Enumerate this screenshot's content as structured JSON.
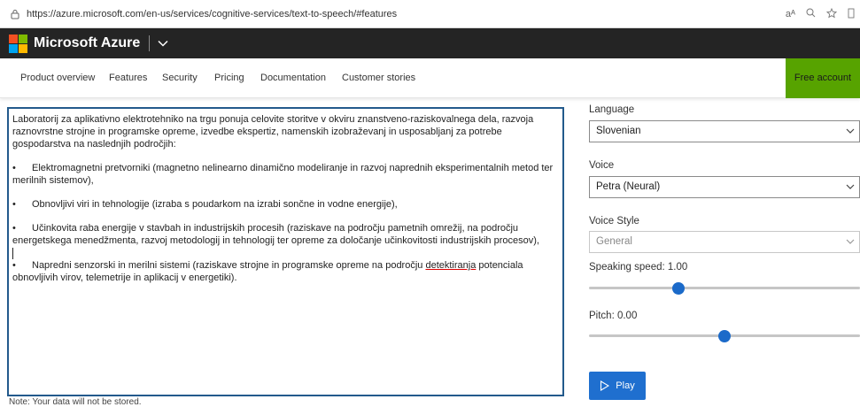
{
  "browser": {
    "url": "https://azure.microsoft.com/en-us/services/cognitive-services/text-to-speech/#features"
  },
  "header": {
    "brand": "Microsoft Azure",
    "logo_colors": [
      "#f25022",
      "#7fba00",
      "#00a4ef",
      "#ffb900"
    ]
  },
  "nav": {
    "items": [
      "Product overview",
      "Features",
      "Security",
      "Pricing",
      "Documentation",
      "Customer stories"
    ],
    "free_account": "Free account",
    "free_account_color": "#57a300"
  },
  "editor": {
    "intro": "Laboratorij za aplikativno elektrotehniko na trgu ponuja celovite storitve v okviru znanstveno-raziskovalnega dela, razvoja raznovrstne strojne in programske opreme, izvedbe ekspertiz, namenskih izobraževanj in usposabljanj za potrebe gospodarstva na naslednjih področjih:",
    "bullet_char": "•",
    "bullets": [
      "Elektromagnetni pretvorniki (magnetno nelinearno dinamično modeliranje in razvoj naprednih eksperimentalnih metod ter merilnih sistemov),",
      "Obnovljivi viri in tehnologije (izraba s poudarkom na izrabi sončne in vodne energije),",
      "Učinkovita raba energije v stavbah in industrijskih procesih (raziskave na področju pametnih omrežij, na področju energetskega menedžmenta, razvoj metodologij in tehnologij ter opreme za določanje učinkovitosti industrijskih procesov),"
    ],
    "last_bullet_before": "Napredni senzorski in merilni sistemi (raziskave strojne in programske opreme na področju ",
    "last_bullet_misspelled": "detektiranja",
    "last_bullet_after": " potenciala obnovljivih virov, telemetrije in aplikacij v energetiki).",
    "border_color": "#235a8c"
  },
  "note": "Note: Your data will not be stored.",
  "settings": {
    "language_label": "Language",
    "language_value": "Slovenian",
    "voice_label": "Voice",
    "voice_value": "Petra (Neural)",
    "style_label": "Voice Style",
    "style_value": "General",
    "speed_label": "Speaking speed: 1.00",
    "speed_fraction": 0.33,
    "pitch_label": "Pitch: 0.00",
    "pitch_fraction": 0.5,
    "play_label": "Play",
    "accent_color": "#1f6fcf"
  }
}
